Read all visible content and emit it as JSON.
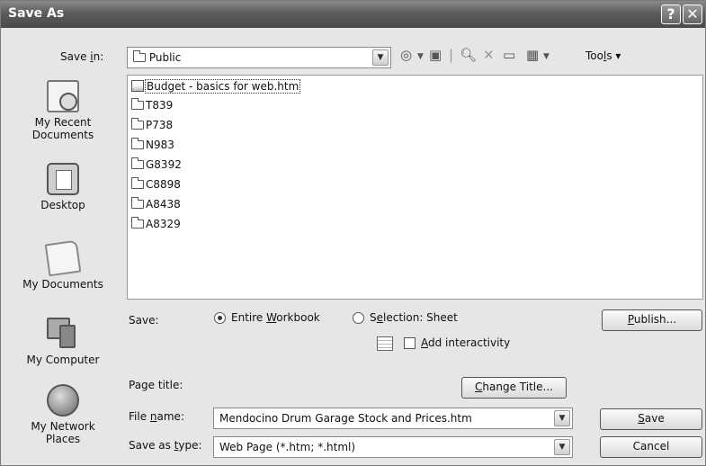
{
  "window": {
    "title": "Save As",
    "help_glyph": "?",
    "close_glyph": "✕"
  },
  "save_in": {
    "label_pre": "Save ",
    "label_key": "i",
    "label_post": "n:",
    "value": "Public"
  },
  "toolbar": {
    "tools_pre": "Too",
    "tools_key": "l",
    "tools_post": "s"
  },
  "places": [
    {
      "label": "My Recent Documents",
      "icon": "recent-documents-icon"
    },
    {
      "label": "Desktop",
      "icon": "desktop-icon"
    },
    {
      "label": "My Documents",
      "icon": "my-documents-icon"
    },
    {
      "label": "My Computer",
      "icon": "my-computer-icon"
    },
    {
      "label": "My Network Places",
      "icon": "network-places-icon"
    }
  ],
  "files": [
    {
      "name": "Budget - basics for web.htm",
      "type": "htm"
    },
    {
      "name": "T839",
      "type": "folder"
    },
    {
      "name": "P738",
      "type": "folder"
    },
    {
      "name": "N983",
      "type": "folder"
    },
    {
      "name": "G8392",
      "type": "folder"
    },
    {
      "name": "C8898",
      "type": "folder"
    },
    {
      "name": "A8438",
      "type": "folder"
    },
    {
      "name": "A8329",
      "type": "folder"
    }
  ],
  "save_options": {
    "label": "Save:",
    "entire_pre": "Entire ",
    "entire_key": "W",
    "entire_post": "orkbook",
    "selection_pre": "S",
    "selection_key": "e",
    "selection_post": "lection: Sheet",
    "interactivity_key": "A",
    "interactivity_post": "dd interactivity",
    "publish_key": "P",
    "publish_post": "ublish..."
  },
  "page_title": {
    "label": "Page title:",
    "change_key": "C",
    "change_post": "hange Title..."
  },
  "file_name": {
    "label_pre": "File ",
    "label_key": "n",
    "label_post": "ame:",
    "value": "Mendocino Drum Garage Stock and Prices.htm"
  },
  "save_as_type": {
    "label_pre": "Save as ",
    "label_key": "t",
    "label_post": "ype:",
    "value": "Web Page (*.htm; *.html)"
  },
  "buttons": {
    "save_key": "S",
    "save_post": "ave",
    "cancel": "Cancel"
  }
}
